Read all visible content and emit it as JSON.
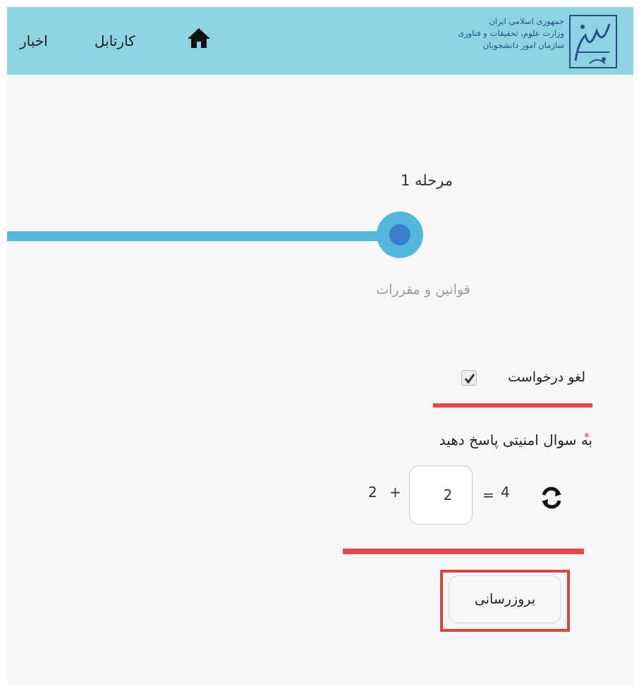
{
  "header": {
    "nav_news": "اخبار",
    "nav_cartable": "کارتابل",
    "home_icon": "home-icon",
    "logo_lines": [
      "جمهوری اسلامی ایران",
      "وزارت علوم، تحقیقات و فناوری",
      "سازمان امور دانشجویان"
    ],
    "background": "#8ed3e2"
  },
  "stepper": {
    "step_title": "مرحله 1",
    "step_subtitle": "قوانین و مقررات",
    "accent": "#54b8dc",
    "dot_color": "#3a7fcb"
  },
  "form": {
    "cancel_label": "لغو درخواست",
    "cancel_checked": true,
    "question": "به سوال امنیتی پاسخ دهید",
    "required_mark": "*",
    "captcha": {
      "operand_a": "2",
      "plus": "+",
      "answer": "2",
      "equals": "=",
      "result": "4"
    },
    "refresh_icon": "refresh-icon",
    "update_button": "بروزرسانی",
    "highlight_color": "#e24a4a"
  }
}
